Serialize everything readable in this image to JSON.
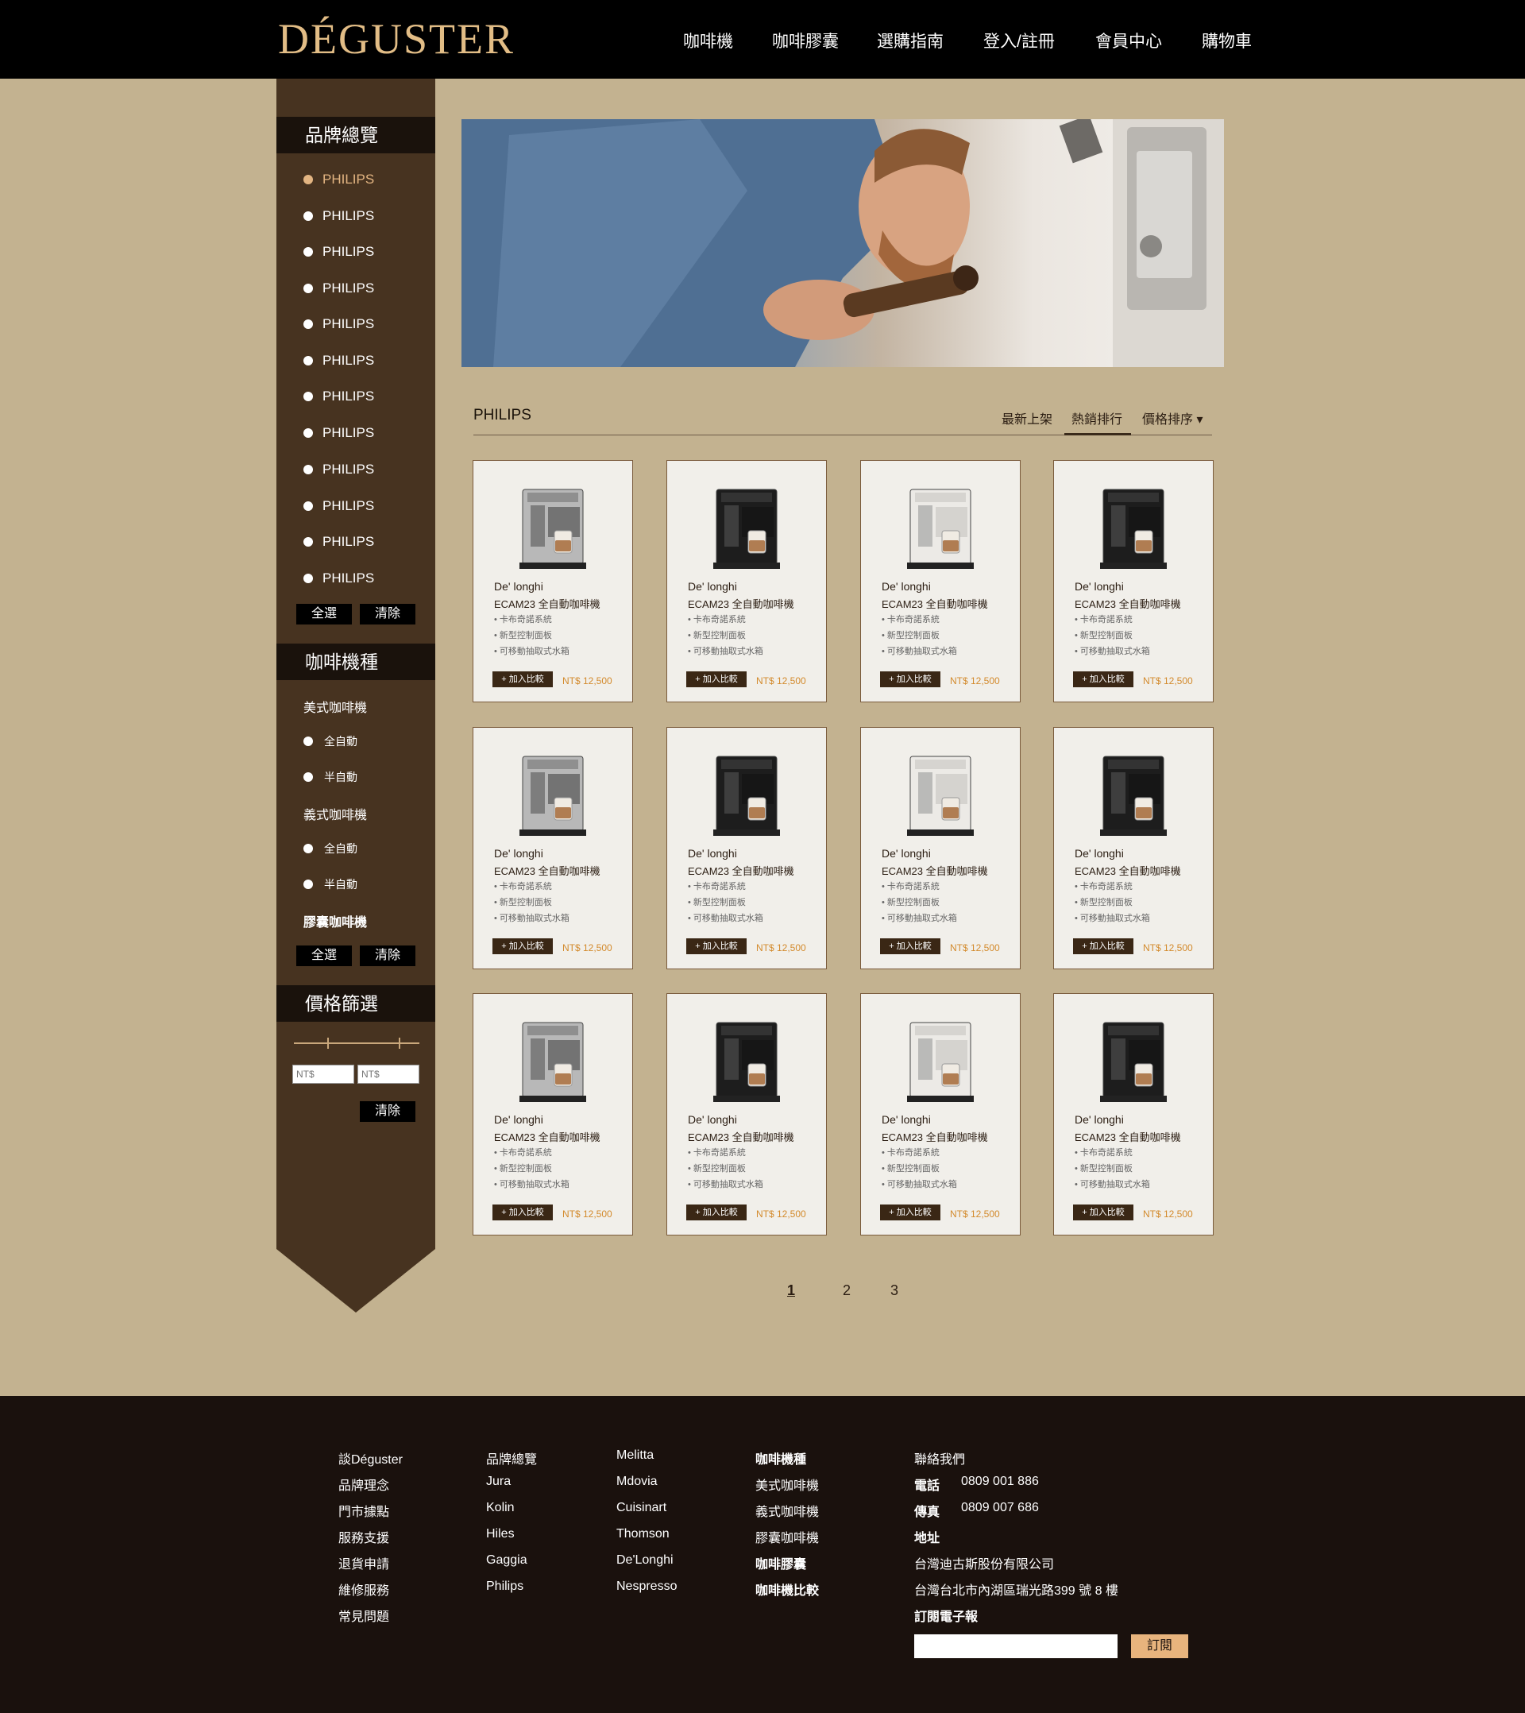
{
  "header": {
    "logo": "DÉGUSTER",
    "nav": [
      "咖啡機",
      "咖啡膠囊",
      "選購指南",
      "登入/註冊",
      "會員中心",
      "購物車"
    ]
  },
  "sidebar": {
    "brand_title": "品牌總覽",
    "brands": [
      "PHILIPS",
      "PHILIPS",
      "PHILIPS",
      "PHILIPS",
      "PHILIPS",
      "PHILIPS",
      "PHILIPS",
      "PHILIPS",
      "PHILIPS",
      "PHILIPS",
      "PHILIPS",
      "PHILIPS"
    ],
    "select_all": "全選",
    "clear": "清除",
    "type_title": "咖啡機種",
    "types": {
      "american": "美式咖啡機",
      "italian": "義式咖啡機",
      "capsule": "膠囊咖啡機",
      "full_auto": "全自動",
      "semi_auto": "半自動"
    },
    "price_title": "價格篩選",
    "price_min_placeholder": "NT$",
    "price_max_placeholder": "NT$"
  },
  "list": {
    "title": "PHILIPS",
    "sort": [
      "最新上架",
      "熱銷排行",
      "價格排序 ▾"
    ],
    "active_sort": "熱銷排行"
  },
  "products": [
    {
      "brand": "De' longhi",
      "model": "ECAM23 全自動咖啡機",
      "features": [
        "• 卡布奇諾系統",
        "• 新型控制面板",
        "• 可移動抽取式水箱"
      ],
      "add": "+ 加入比較",
      "price": "NT$ 12,500",
      "style": "silver"
    },
    {
      "brand": "De' longhi",
      "model": "ECAM23 全自動咖啡機",
      "features": [
        "• 卡布奇諾系統",
        "• 新型控制面板",
        "• 可移動抽取式水箱"
      ],
      "add": "+ 加入比較",
      "price": "NT$ 12,500",
      "style": "black"
    },
    {
      "brand": "De' longhi",
      "model": "ECAM23 全自動咖啡機",
      "features": [
        "• 卡布奇諾系統",
        "• 新型控制面板",
        "• 可移動抽取式水箱"
      ],
      "add": "+ 加入比較",
      "price": "NT$ 12,500",
      "style": "white"
    },
    {
      "brand": "De' longhi",
      "model": "ECAM23 全自動咖啡機",
      "features": [
        "• 卡布奇諾系統",
        "• 新型控制面板",
        "• 可移動抽取式水箱"
      ],
      "add": "+ 加入比較",
      "price": "NT$ 12,500",
      "style": "black2"
    },
    {
      "brand": "De' longhi",
      "model": "ECAM23 全自動咖啡機",
      "features": [
        "• 卡布奇諾系統",
        "• 新型控制面板",
        "• 可移動抽取式水箱"
      ],
      "add": "+ 加入比較",
      "price": "NT$ 12,500",
      "style": "silver"
    },
    {
      "brand": "De' longhi",
      "model": "ECAM23 全自動咖啡機",
      "features": [
        "• 卡布奇諾系統",
        "• 新型控制面板",
        "• 可移動抽取式水箱"
      ],
      "add": "+ 加入比較",
      "price": "NT$ 12,500",
      "style": "black"
    },
    {
      "brand": "De' longhi",
      "model": "ECAM23 全自動咖啡機",
      "features": [
        "• 卡布奇諾系統",
        "• 新型控制面板",
        "• 可移動抽取式水箱"
      ],
      "add": "+ 加入比較",
      "price": "NT$ 12,500",
      "style": "white"
    },
    {
      "brand": "De' longhi",
      "model": "ECAM23 全自動咖啡機",
      "features": [
        "• 卡布奇諾系統",
        "• 新型控制面板",
        "• 可移動抽取式水箱"
      ],
      "add": "+ 加入比較",
      "price": "NT$ 12,500",
      "style": "black2"
    },
    {
      "brand": "De' longhi",
      "model": "ECAM23 全自動咖啡機",
      "features": [
        "• 卡布奇諾系統",
        "• 新型控制面板",
        "• 可移動抽取式水箱"
      ],
      "add": "+ 加入比較",
      "price": "NT$ 12,500",
      "style": "silver"
    },
    {
      "brand": "De' longhi",
      "model": "ECAM23 全自動咖啡機",
      "features": [
        "• 卡布奇諾系統",
        "• 新型控制面板",
        "• 可移動抽取式水箱"
      ],
      "add": "+ 加入比較",
      "price": "NT$ 12,500",
      "style": "black"
    },
    {
      "brand": "De' longhi",
      "model": "ECAM23 全自動咖啡機",
      "features": [
        "• 卡布奇諾系統",
        "• 新型控制面板",
        "• 可移動抽取式水箱"
      ],
      "add": "+ 加入比較",
      "price": "NT$ 12,500",
      "style": "white"
    },
    {
      "brand": "De' longhi",
      "model": "ECAM23 全自動咖啡機",
      "features": [
        "• 卡布奇諾系統",
        "• 新型控制面板",
        "• 可移動抽取式水箱"
      ],
      "add": "+ 加入比較",
      "price": "NT$ 12,500",
      "style": "black2"
    }
  ],
  "pagination": {
    "pages": [
      "1",
      "2",
      "3"
    ],
    "current": "1"
  },
  "footer": {
    "col1": [
      "談Déguster",
      "品牌理念",
      "門市據點",
      "服務支援",
      "退貨申請",
      "維修服務",
      "常見問題"
    ],
    "col2": [
      "品牌總覽",
      "Jura",
      "Kolin",
      "Hiles",
      "Gaggia",
      "Philips"
    ],
    "col3": [
      "Melitta",
      "Mdovia",
      "Cuisinart",
      "Thomson",
      "De'Longhi",
      "Nespresso"
    ],
    "col4": [
      "咖啡機種",
      "美式咖啡機",
      "義式咖啡機",
      "膠囊咖啡機",
      "咖啡膠囊",
      "咖啡機比較"
    ],
    "contact": {
      "title": "聯絡我們",
      "tel_label": "電話",
      "tel": "0809 001 886",
      "fax_label": "傳真",
      "fax": "0809 007 686",
      "addr_label": "地址",
      "company": "台灣迪古斯股份有限公司",
      "address": "台灣台北市內湖區瑞光路399 號 8 樓",
      "newsletter": "訂閱電子報",
      "subscribe": "訂閱"
    }
  },
  "colors": {
    "accent": "#e3b582",
    "price": "#d38a2c",
    "sidebar": "#473320",
    "page_bg": "#c3b290"
  }
}
